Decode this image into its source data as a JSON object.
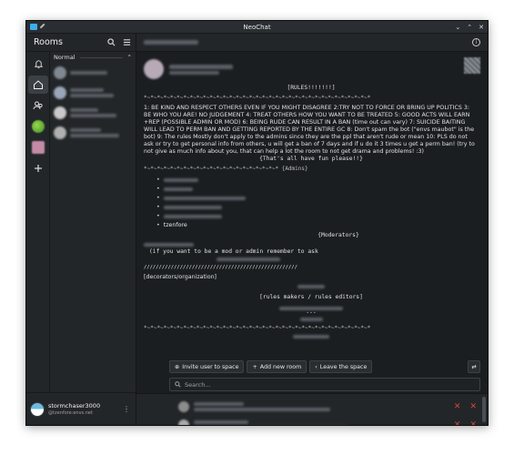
{
  "window": {
    "title": "NeoChat"
  },
  "sidebar": {
    "title": "Rooms",
    "section_label": "Normal",
    "rooms_count": 4
  },
  "user": {
    "name": "stormchaser3000",
    "id": "@tzenfore:envs.net"
  },
  "content": {
    "rules_title": "[RULES!!!!!!!]",
    "separator": "*~*~*~*~*~*~*~*~*~*~*~*~*~*~*~*~*~*~*~*~*~*~*~*~*~*~*~*~*~*~*~*~*~*~*",
    "rules_text": "1: BE KIND AND RESPECT OTHERS EVEN IF YOU MIGHT DISAGREE 2:TRY NOT TO FORCE OR BRING UP POLITICS 3: BE WHO YOU ARE! NO JUDGEMENT 4: TREAT OTHERS HOW YOU WANT TO BE TREATED 5: GOOD ACTS WILL EARN +REP (POSSIBLE ADMIN OR MOD) 6: BEING RUDE CAN RESULT IN A BAN (time out can vary) 7: SUICIDE BAITING WILL LEAD TO PERM BAN AND GETTING REPORTED BY THE ENTIRE GC 8: Don't spam the bot (\"envs maubot\" is the bot) 9: The rules Mostly don't apply to the admins since they are the ppl that aren't rude or mean 10: PLS do not ask or try to get personal info from others, u will get a ban of 7 days and if u do it 3 times u get a perm ban! (try to not give as much info about you, that can help a lot the room to not get drama and problems! :3)",
    "fun_line": "{That's all have fun please!!}",
    "admins_header": "*~*~*~*~*~*~*~*~*~*~*~*~*~*~*~*~*~*~*~*~* {Admins}",
    "admin_visible": "tzenfore",
    "moderators_header": "{Moderators}",
    "mod_note_1": "(if you want to be a mod or admin remember to ask",
    "slashes": "///////////////////////////////////////////////////",
    "decorators": "[decorators/organization]",
    "rules_makers": "[rules makers / rules editors]",
    "dashes": "---"
  },
  "actions": {
    "invite": "Invite user to space",
    "add_room": "Add new room",
    "leave": "Leave the space"
  },
  "search": {
    "placeholder": "Search..."
  }
}
